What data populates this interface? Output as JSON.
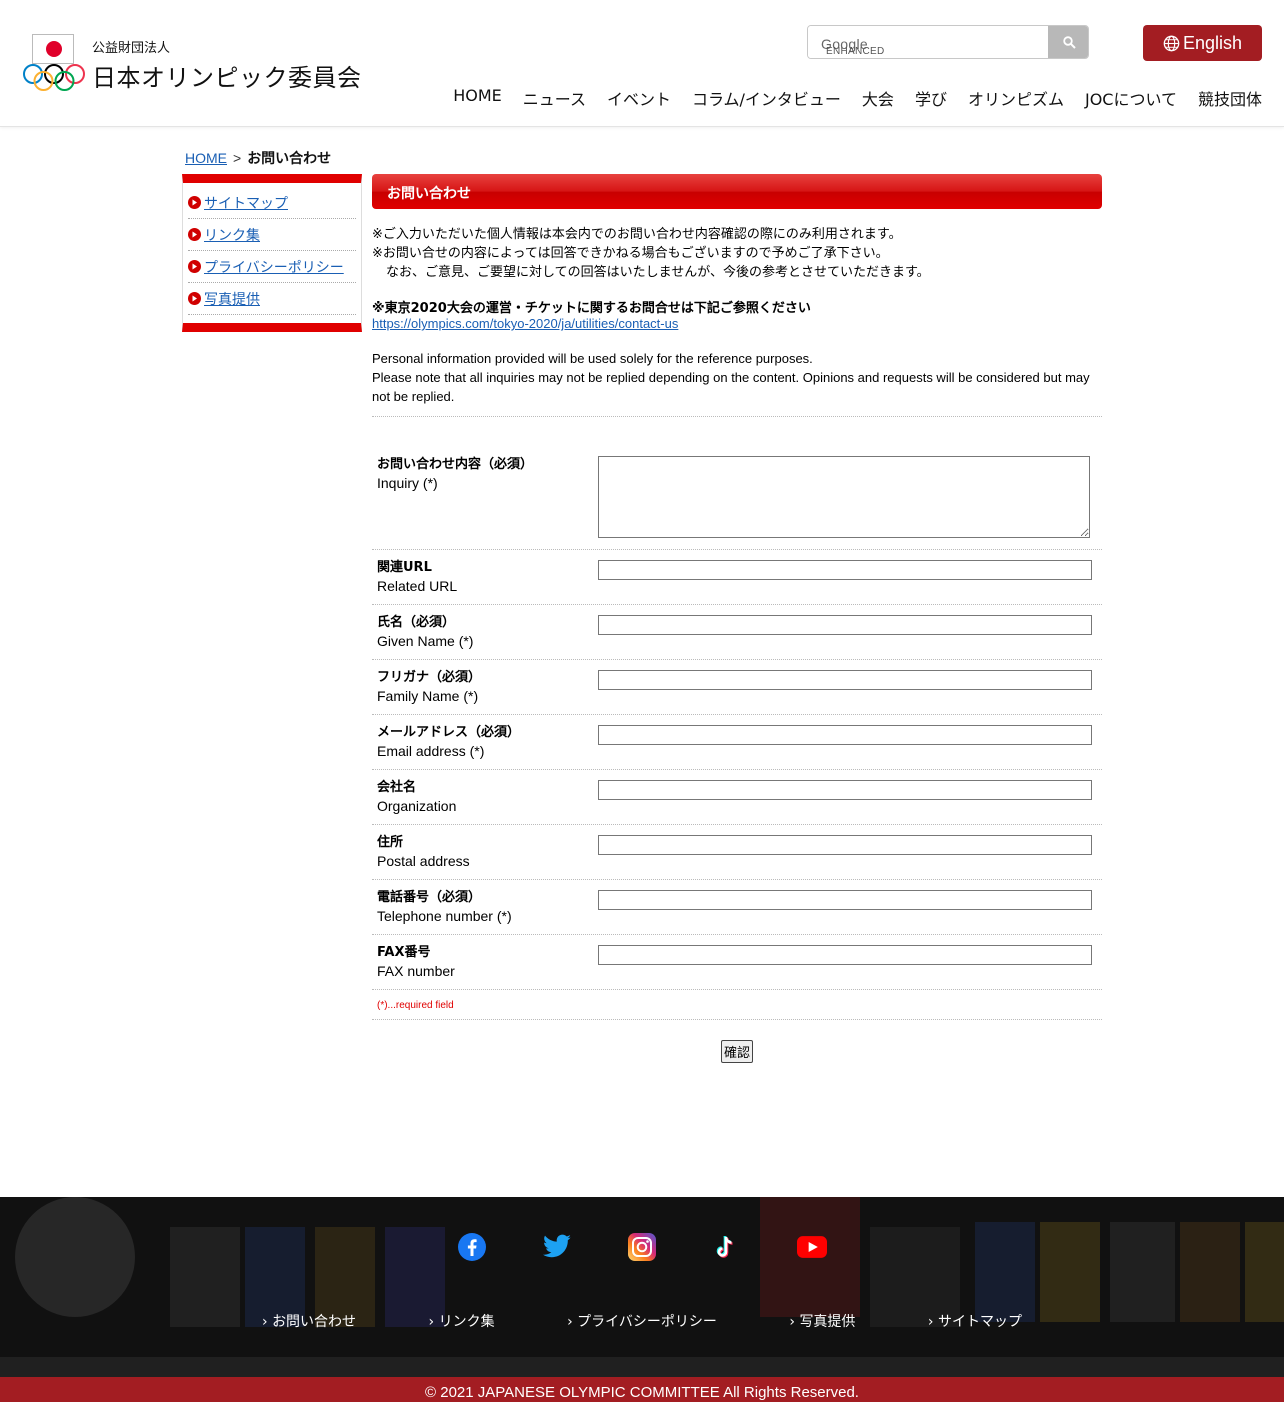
{
  "header": {
    "logo_sub": "公益財団法人",
    "logo_main": "日本オリンピック委員会",
    "search_label": "ENHANCED BY",
    "search_brand": "Google",
    "lang_button": "English",
    "nav": [
      "HOME",
      "ニュース",
      "イベント",
      "コラム/インタビュー",
      "大会",
      "学び",
      "オリンピズム",
      "JOCについて",
      "競技団体"
    ]
  },
  "breadcrumb": {
    "home": "HOME",
    "sep": ">",
    "current": "お問い合わせ"
  },
  "sidebar": {
    "items": [
      "サイトマップ",
      "リンク集",
      "プライバシーポリシー",
      "写真提供"
    ]
  },
  "main": {
    "title": "お問い合わせ",
    "notes": [
      "※ご入力いただいた個人情報は本会内でのお問い合わせ内容確認の際にのみ利用されます。",
      "※お問い合せの内容によっては回答できかねる場合もございますので予めご了承下さい。",
      "なお、ご意見、ご要望に対しての回答はいたしませんが、今後の参考とさせていただきます。"
    ],
    "tokyo_note": "※東京2020大会の運営・チケットに関するお問合せは下記ご参照ください",
    "tokyo_link": "https://olympics.com/tokyo-2020/ja/utilities/contact-us",
    "en_notes": [
      "Personal information provided will be used solely for the reference purposes.",
      "Please note that all inquiries may not be replied depending on the content. Opinions and requests will be considered but may not be replied."
    ]
  },
  "form": {
    "fields": [
      {
        "ja": "お問い合わせ内容（必須）",
        "en": "Inquiry (*)"
      },
      {
        "ja": "関連URL",
        "en": "Related URL"
      },
      {
        "ja": "氏名（必須）",
        "en": "Given Name (*)"
      },
      {
        "ja": "フリガナ（必須）",
        "en": "Family Name (*)"
      },
      {
        "ja": "メールアドレス（必須）",
        "en": "Email address (*)"
      },
      {
        "ja": "会社名",
        "en": "Organization"
      },
      {
        "ja": "住所",
        "en": "Postal address"
      },
      {
        "ja": "電話番号（必須）",
        "en": "Telephone number (*)"
      },
      {
        "ja": "FAX番号",
        "en": "FAX number"
      }
    ],
    "required_note": "(*)...required field",
    "submit": "確認"
  },
  "footer": {
    "social": [
      "facebook-icon",
      "twitter-icon",
      "instagram-icon",
      "tiktok-icon",
      "youtube-icon"
    ],
    "links": [
      "お問い合わせ",
      "リンク集",
      "プライバシーポリシー",
      "写真提供",
      "サイトマップ"
    ],
    "copyright": "© 2021 JAPANESE OLYMPIC COMMITTEE All Rights Reserved."
  },
  "colors": {
    "accent_red": "#e00000",
    "brand_dark_red": "#a31d22",
    "link": "#1a5fb4"
  }
}
